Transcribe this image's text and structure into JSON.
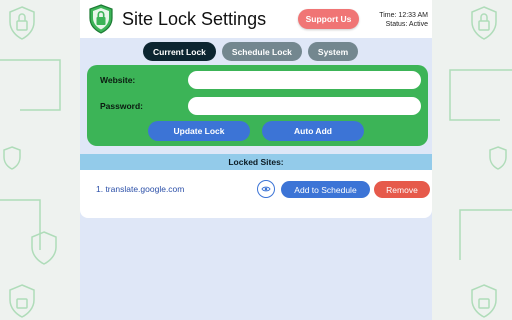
{
  "header": {
    "title": "Site Lock Settings",
    "support_label": "Support Us",
    "time_text": "Time: 12:33 AM",
    "status_text": "Status: Active"
  },
  "tabs": [
    {
      "label": "Current Lock",
      "active": true
    },
    {
      "label": "Schedule Lock",
      "active": false
    },
    {
      "label": "System",
      "active": false
    }
  ],
  "form": {
    "website_label": "Website:",
    "website_value": "",
    "password_label": "Password:",
    "password_value": "",
    "update_label": "Update Lock",
    "auto_add_label": "Auto Add"
  },
  "locked": {
    "header": "Locked Sites:",
    "items": [
      {
        "text": "1. translate.google.com",
        "schedule_label": "Add to Schedule",
        "remove_label": "Remove"
      }
    ]
  },
  "colors": {
    "accent_green": "#3cb457",
    "primary_blue": "#3c74d6",
    "danger_red": "#e65a4b",
    "support_pink": "#f07575",
    "tab_active": "#0c2530",
    "tab_inactive": "#73878f"
  },
  "icons": {
    "logo": "shield-lock-icon",
    "eye": "eye-icon",
    "background": "shield-lock-icon"
  }
}
